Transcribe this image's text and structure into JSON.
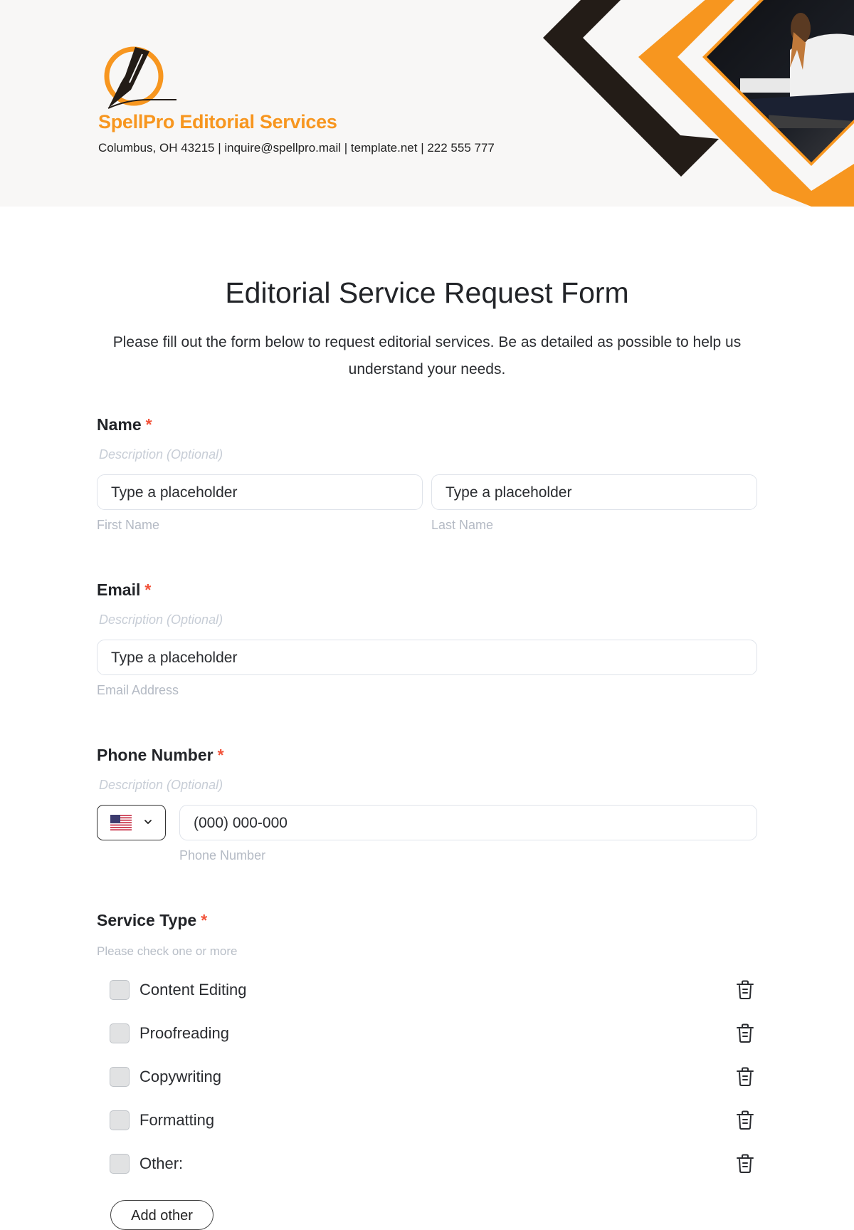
{
  "header": {
    "company_name": "SpellPro Editorial Services",
    "contact_line": "Columbus, OH 43215 | inquire@spellpro.mail | template.net | 222 555 777",
    "colors": {
      "accent": "#f7961f",
      "dark": "#231c17",
      "background": "#f8f7f6"
    }
  },
  "form": {
    "title": "Editorial Service Request Form",
    "intro": "Please fill out the form below to request editorial services. Be as detailed as possible to help us understand your needs.",
    "required_marker": "*",
    "name": {
      "label": "Name",
      "description": "Description (Optional)",
      "first": {
        "placeholder": "Type a placeholder",
        "sublabel": "First Name"
      },
      "last": {
        "placeholder": "Type a placeholder",
        "sublabel": "Last Name"
      }
    },
    "email": {
      "label": "Email",
      "description": "Description (Optional)",
      "placeholder": "Type a placeholder",
      "sublabel": "Email Address"
    },
    "phone": {
      "label": "Phone Number",
      "description": "Description (Optional)",
      "country_icon": "us-flag-icon",
      "placeholder": "(000) 000-000",
      "sublabel": "Phone Number"
    },
    "service_type": {
      "label": "Service Type",
      "hint": "Please check one or more",
      "options": [
        {
          "label": "Content Editing",
          "checked": false
        },
        {
          "label": "Proofreading",
          "checked": false
        },
        {
          "label": "Copywriting",
          "checked": false
        },
        {
          "label": "Formatting",
          "checked": false
        },
        {
          "label": "Other:",
          "checked": false
        }
      ],
      "add_other_label": "Add other"
    }
  }
}
